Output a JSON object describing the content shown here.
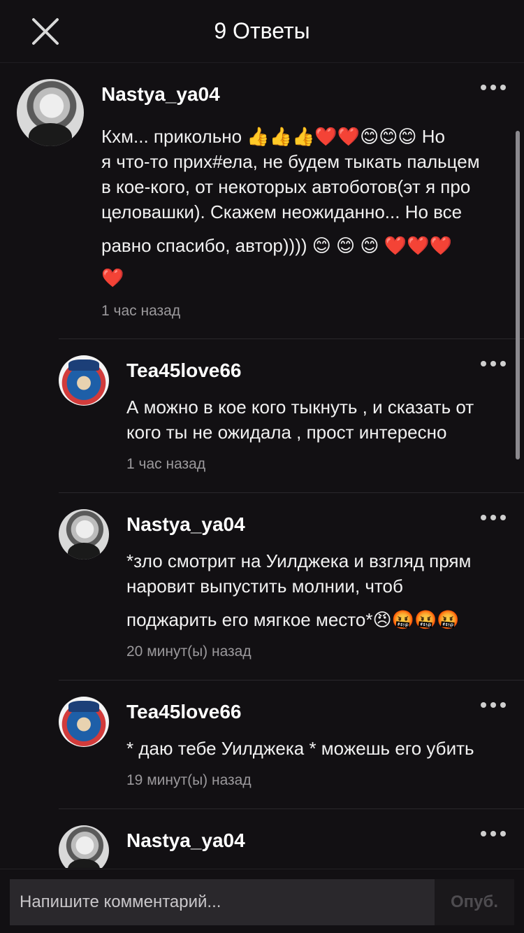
{
  "header": {
    "title": "9 Ответы"
  },
  "icons": {
    "close": "close-icon",
    "more": "more-options-icon"
  },
  "comments": [
    {
      "username": "Nastya_ya04",
      "lines": [
        "Кхм... прикольно 👍👍👍❤️❤️😊😊😊 Но",
        "я что-то прих#ела, не будем тыкать пальцем",
        "в кое-кого, от некоторых автоботов(эт я про",
        "целовашки). Скажем неожиданно... Но все",
        "равно спасибо, автор)))) 😊 😊 😊 ❤️❤️❤️",
        "❤️"
      ],
      "time": "1 час назад"
    },
    {
      "username": "Tea45love66",
      "lines": [
        "А можно в кое кого тыкнуть , и сказать от",
        "кого ты не ожидала , прост интересно"
      ],
      "time": "1 час назад"
    },
    {
      "username": "Nastya_ya04",
      "lines": [
        "*зло смотрит на Уилджека и взгляд прям",
        "наровит выпустить молнии, чтоб",
        "поджарить его мягкое место*😠🤬🤬🤬"
      ],
      "time": "20 минут(ы) назад"
    },
    {
      "username": "Tea45love66",
      "lines": [
        "* даю тебе Уилджека * можешь его убить"
      ],
      "time": "19 минут(ы) назад"
    },
    {
      "username": "Nastya_ya04",
      "lines": [],
      "time": ""
    }
  ],
  "composer": {
    "placeholder": "Напишите комментарий...",
    "publish_label": "Опуб."
  }
}
